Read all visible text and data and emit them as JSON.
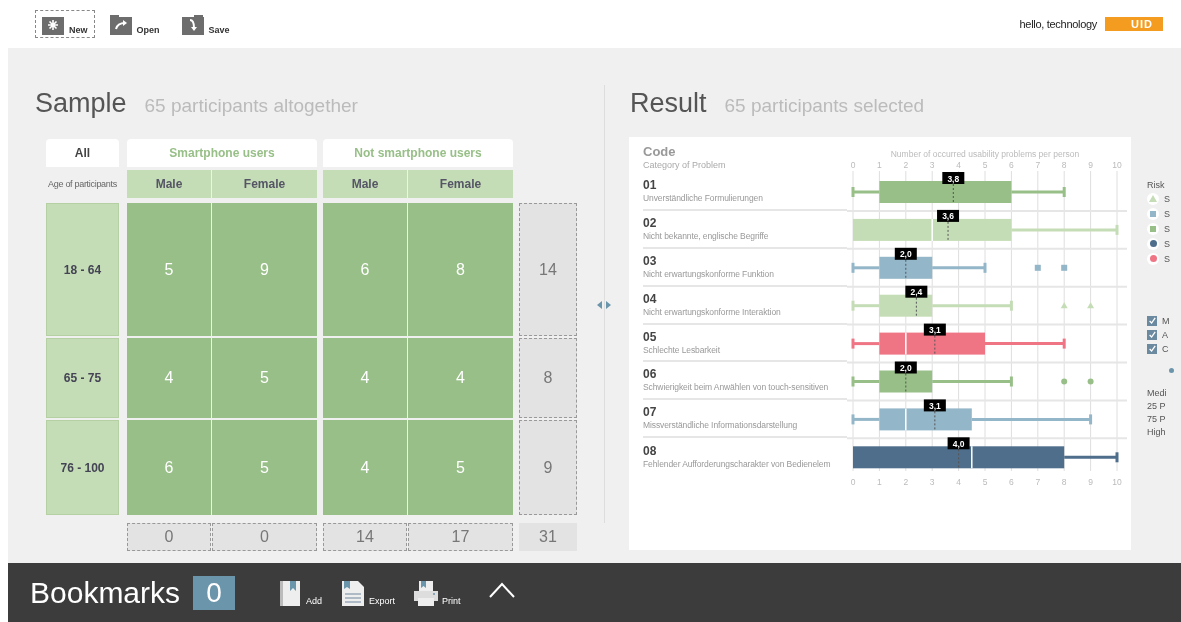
{
  "toolbar": {
    "buttons": [
      {
        "label": "New",
        "selected": true
      },
      {
        "label": "Open",
        "selected": false
      },
      {
        "label": "Save",
        "selected": false
      }
    ],
    "greeting": "hello, technology",
    "logo": "UID"
  },
  "sample": {
    "title": "Sample",
    "subtitle": "65 participants altogether",
    "tabs": [
      {
        "label": "All",
        "kind": "filter"
      },
      {
        "label": "Smartphone users",
        "kind": "group"
      },
      {
        "label": "Not smartphone users",
        "kind": "group"
      }
    ],
    "age_label": "Age of participants",
    "subheaders": [
      "Male",
      "Female",
      "Male",
      "Female"
    ],
    "rows": [
      {
        "age": "18 - 64",
        "values": [
          "5",
          "9",
          "6",
          "8"
        ],
        "total": "14"
      },
      {
        "age": "65 - 75",
        "values": [
          "4",
          "5",
          "4",
          "4"
        ],
        "total": "8"
      },
      {
        "age": "76 - 100",
        "values": [
          "6",
          "5",
          "4",
          "5"
        ],
        "total": "9"
      }
    ],
    "column_totals": [
      "0",
      "0",
      "14",
      "17"
    ],
    "grand_total": "31"
  },
  "result": {
    "title": "Result",
    "subtitle": "65 participants selected",
    "code_heading": "Code",
    "category_heading": "Category of Problem",
    "problems": [
      {
        "code": "01",
        "text": "Unverständliche Formulierungen",
        "color": "#97bf87",
        "mean_label": "3,8"
      },
      {
        "code": "02",
        "text": "Nicht bekannte, englische Begriffe",
        "color": "#c5ddb6",
        "mean_label": "3,6"
      },
      {
        "code": "03",
        "text": "Nicht erwartungskonforme Funktion",
        "color": "#93b6c8",
        "mean_label": "2,0",
        "kind": "square"
      },
      {
        "code": "04",
        "text": "Nicht erwartungskonforme Interaktion",
        "color": "#c5ddb6",
        "mean_label": "2,4",
        "kind": "triangle"
      },
      {
        "code": "05",
        "text": "Schlechte Lesbarkeit",
        "color": "#ef7585",
        "mean_label": "3,1"
      },
      {
        "code": "06",
        "text": "Schwierigkeit beim Anwählen von touch-sensitiven",
        "color": "#97bf87",
        "mean_label": "2,0",
        "kind": "circle"
      },
      {
        "code": "07",
        "text": "Missverständliche Informationsdarstellung",
        "color": "#93b6c8",
        "mean_label": "3,1"
      },
      {
        "code": "08",
        "text": "Fehlender Aufforderungscharakter von Bedienelem",
        "color": "#4e6e8c",
        "mean_label": "4,0"
      }
    ],
    "axis": {
      "title": "Number of occurred usability problems per person",
      "top_ticks": [
        "0",
        "1",
        "2",
        "3",
        "4",
        "5",
        "6",
        "7",
        "8",
        "9",
        "10"
      ],
      "bottom_ticks": [
        "0",
        "1",
        "2",
        "3",
        "4",
        "5",
        "6",
        "7",
        "8",
        "9",
        "10"
      ]
    },
    "legend": {
      "title": "Risk",
      "items": [
        {
          "label": "S",
          "color": "#c5ddb6",
          "kind": "triangle"
        },
        {
          "label": "S",
          "color": "#93b6c8",
          "kind": "square"
        },
        {
          "label": "S",
          "color": "#97bf87",
          "kind": "square"
        },
        {
          "label": "S",
          "color": "#4e6e8c",
          "kind": "circle"
        },
        {
          "label": "S",
          "color": "#ef7585",
          "kind": "circle"
        }
      ],
      "options": [
        {
          "label": "M",
          "checked": true
        },
        {
          "label": "A",
          "checked": true
        },
        {
          "label": "C",
          "checked": true
        }
      ],
      "notes": [
        "Medi",
        "25 P",
        "75 P",
        "High"
      ]
    }
  },
  "bookmarks": {
    "title": "Bookmarks",
    "count": "0",
    "actions": [
      {
        "label": "Add"
      },
      {
        "label": "Export"
      },
      {
        "label": "Print"
      }
    ]
  }
}
